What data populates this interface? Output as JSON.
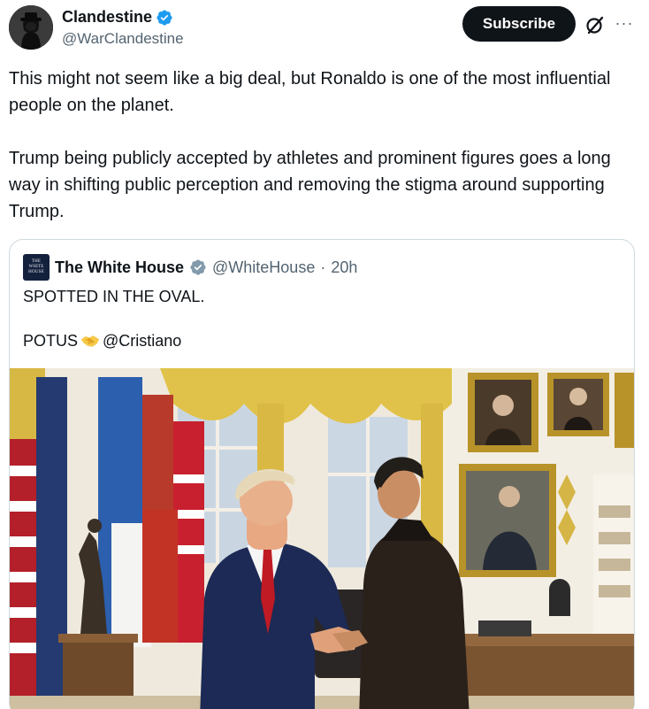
{
  "author": {
    "display_name": "Clandestine",
    "handle": "@WarClandestine",
    "avatar_icon": "hooded-figure-avatar",
    "verified_icon": "verified-badge-icon",
    "verified_color": "#1d9bf0"
  },
  "actions": {
    "subscribe_label": "Subscribe",
    "grok_icon": "grok-icon",
    "more_icon": "more-options-icon",
    "more_glyph": "···"
  },
  "tweet": {
    "paragraphs": [
      "This might not seem like a big deal, but Ronaldo is one of the most influential people on the planet.",
      "Trump being publicly accepted by athletes and prominent figures goes a long way in shifting public perception and removing the stigma around supporting Trump."
    ]
  },
  "quoted": {
    "display_name": "The White House",
    "handle": "@WhiteHouse",
    "separator": "·",
    "time": "20h",
    "avatar_line1": "THE",
    "avatar_line2": "WHITE",
    "avatar_line3": "HOUSE",
    "verified_icon": "gray-verified-badge-icon",
    "verified_color": "#829aab",
    "line1": "SPOTTED IN THE OVAL.",
    "line2_prefix": "POTUS",
    "line2_emoji": "handshake-emoji",
    "line2_mention": "@Cristiano",
    "image_description_icon": "oval-office-handshake-photo"
  },
  "colors": {
    "text_primary": "#0f1419",
    "text_secondary": "#536471",
    "border": "#cfd9de",
    "button_bg": "#0f1419"
  }
}
